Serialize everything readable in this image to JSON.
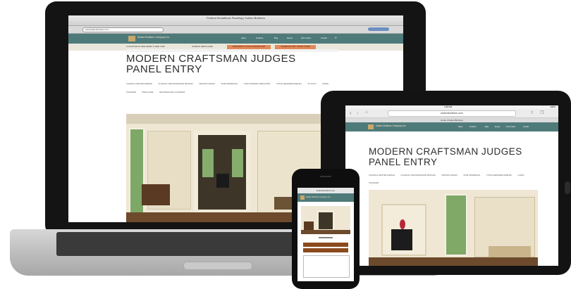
{
  "site": {
    "browser_title": "Federal Woodblock Paneling | Kuiken Brothers",
    "url": "www.kuikenbrothers.com",
    "logo_name": "Kuiken Brothers Company Inc.",
    "nav": [
      "About",
      "Products",
      "Blog",
      "Events",
      "Find a Store",
      "Contact"
    ],
    "promo_left": "6 LOCATIONS IN NEW JERSEY & NEW YORK",
    "promo_mid": "IN-DEPTH DEMO GUIDE",
    "promo_btn1": "SUBSCRIBE TO OUR E-NEWSLETTER",
    "promo_btn2": "SCHEDULE VISIT / SHOW STORE",
    "page_title_line1": "MODERN CRAFTSMAN JUDGES",
    "page_title_line2": "PANEL ENTRY",
    "tags": [
      "CLASSICAL CRAFTER SAMPLES",
      "CLASSICAL CRAFTER MOLDING PROFILES",
      "CRAFTED CASINGS",
      "STAIR HANDRAILING",
      "GOOD STANDARD JAMB GOODS",
      "TYPICAL RECESSED PANELING",
      "STYLISTIC",
      "CASING",
      "T&G BOARD",
      "PANEL GUIDE",
      "CRAFTSMAN WALLS & BOARDS"
    ]
  },
  "tablet": {
    "status_time": "1:09 PM",
    "url": "kuikenbrothers.com",
    "tab_title": "Home | Kuiken Brothers",
    "battery": "100%"
  },
  "phone": {
    "url": "kuikenbrothers.com"
  },
  "colors": {
    "header_teal": "#4f7a7a",
    "promo_orange": "#e08a5a",
    "logo_gold": "#c8a76b"
  }
}
